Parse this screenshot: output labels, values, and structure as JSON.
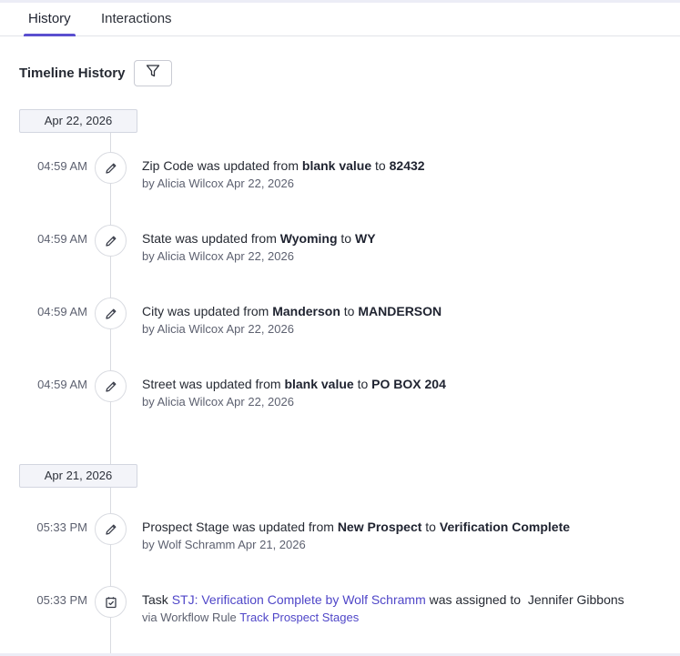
{
  "tabs": {
    "history": "History",
    "interactions": "Interactions"
  },
  "section_title": "Timeline History",
  "groups": [
    {
      "date": "Apr 22, 2026",
      "entries": [
        {
          "time": "04:59 AM",
          "field": "Zip Code",
          "mid": "was updated from",
          "from": "blank value",
          "to_word": "to",
          "to": "82432",
          "by_label": "by",
          "by": "Alicia Wilcox",
          "date": "Apr 22, 2026"
        },
        {
          "time": "04:59 AM",
          "field": "State",
          "mid": "was updated from",
          "from": "Wyoming",
          "to_word": "to",
          "to": "WY",
          "by_label": "by",
          "by": "Alicia Wilcox",
          "date": "Apr 22, 2026"
        },
        {
          "time": "04:59 AM",
          "field": "City",
          "mid": "was updated from",
          "from": "Manderson",
          "to_word": "to",
          "to": "MANDERSON",
          "by_label": "by",
          "by": "Alicia Wilcox",
          "date": "Apr 22, 2026"
        },
        {
          "time": "04:59 AM",
          "field": "Street",
          "mid": "was updated from",
          "from": "blank value",
          "to_word": "to",
          "to": "PO BOX 204",
          "by_label": "by",
          "by": "Alicia Wilcox",
          "date": "Apr 22, 2026"
        }
      ]
    },
    {
      "date": "Apr 21, 2026",
      "entries": [
        {
          "time": "05:33 PM",
          "field": "Prospect Stage",
          "mid": "was updated from",
          "from": "New Prospect",
          "to_word": "to",
          "to": "Verification Complete",
          "by_label": "by",
          "by": "Wolf Schramm",
          "date": "Apr 21, 2026"
        }
      ],
      "task": {
        "time": "05:33 PM",
        "prefix": "Task",
        "task_link": "STJ: Verification Complete by Wolf Schramm",
        "mid": "was assigned to",
        "assignee": "Jennifer Gibbons",
        "via_label": "via Workflow Rule",
        "rule_link": "Track Prospect Stages"
      }
    }
  ],
  "icons": {
    "edit": "pencil-icon",
    "task": "task-check-icon",
    "filter": "filter-icon"
  },
  "colors": {
    "accent": "#5a4fcf",
    "link": "#4f46c8"
  }
}
